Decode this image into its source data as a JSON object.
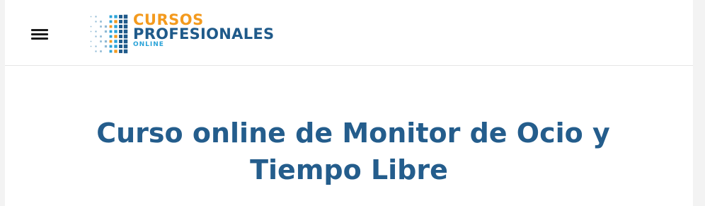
{
  "colors": {
    "brand_orange": "#f39a1e",
    "brand_blue": "#1f5a8a",
    "brand_cyan": "#2aa3d8",
    "title_blue": "#245d8c"
  },
  "header": {
    "menu_icon": "hamburger-menu-icon",
    "logo": {
      "line1": "CURSOS",
      "line2": "PROFESIONALES",
      "line3": "ONLINE"
    }
  },
  "main": {
    "title_line1": "Curso online de Monitor de Ocio y",
    "title_line2": "Tiempo Libre"
  }
}
